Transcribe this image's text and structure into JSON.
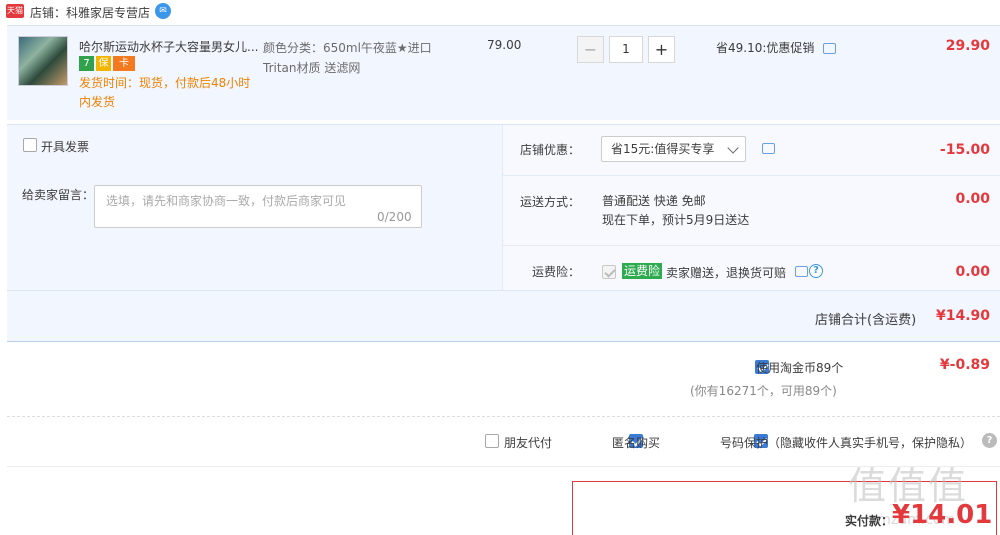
{
  "shop": {
    "badge": "天猫",
    "label": "店铺：科雅家居专营店",
    "ww_icon": "ww-chat-icon"
  },
  "item": {
    "title": "哈尔斯运动水杯子大容量男女儿...",
    "badges": [
      "7",
      "保",
      "卡"
    ],
    "ship_time": "发货时间：现货，付款后48小时内发货",
    "sku": "颜色分类：650ml午夜蓝★进口Tritan材质 送滤网",
    "unit_price": "79.00",
    "quantity": "1",
    "minus": "−",
    "plus": "+",
    "promo": "省49.10:优惠促销",
    "total": "29.90"
  },
  "options": {
    "invoice_label": "开具发票",
    "message_label": "给卖家留言：",
    "message_placeholder": "选填，请先和商家协商一致，付款后商家可见",
    "message_count": "0/200",
    "shop_discount_label": "店铺优惠：",
    "shop_discount_value": "省15元:值得买专享",
    "shop_discount_amount": "-15.00",
    "shipping_label": "运送方式：",
    "shipping_line1": "普通配送 快递 免邮",
    "shipping_line2": "现在下单，预计5月9日送达",
    "shipping_amount": "0.00",
    "insurance_label": "运费险：",
    "insurance_tag": "运费险",
    "insurance_text": "卖家赠送，退换货可赔",
    "insurance_amount": "0.00",
    "shop_total_label": "店铺合计(含运费)",
    "shop_total": "¥14.90"
  },
  "coins": {
    "label": "使用淘金币89个",
    "sub": "(你有16271个，可用89个)",
    "amount": "¥-0.89",
    "checked": true
  },
  "privacy": {
    "friend_pay": "朋友代付",
    "anonymous": "匿名购买",
    "phone_protect": "号码保护（隐藏收件人真实手机号，保护隐私）",
    "help": "?"
  },
  "pay": {
    "label": "实付款：",
    "amount": "¥14.01"
  },
  "watermark": {
    "text": "值值值",
    "url": "smzdm.com"
  },
  "colors": {
    "price_red": "#e4393c",
    "row_bg": "#f2f6fe",
    "accent_blue": "#3a7bd5",
    "ship_orange": "#f08200",
    "insurance_green": "#2eaa4f"
  }
}
